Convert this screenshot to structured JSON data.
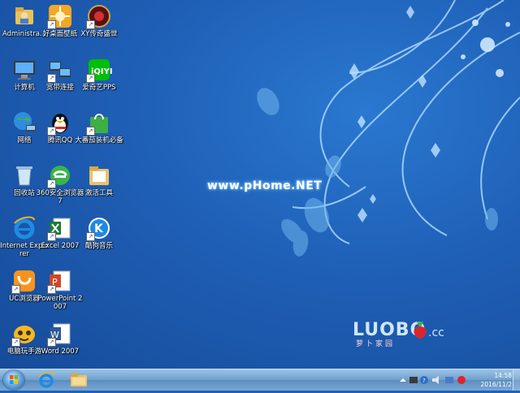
{
  "desktop": {
    "watermark": "www.pHome.NET",
    "brand": {
      "name": "LUOBO",
      "tld": ".cc",
      "subtitle": "萝卜家园"
    },
    "icons": [
      {
        "label": "Administra..."
      },
      {
        "label": "好桌面壁纸"
      },
      {
        "label": "XY传奇盛世"
      },
      {
        "label": "计算机"
      },
      {
        "label": "宽带连接"
      },
      {
        "label": "爱奇艺PPS"
      },
      {
        "label": "网络"
      },
      {
        "label": "腾讯QQ"
      },
      {
        "label": "大番茄装机必备"
      },
      {
        "label": "回收站"
      },
      {
        "label": "360安全浏览器7"
      },
      {
        "label": "激活工具"
      },
      {
        "label": "Internet Explorer"
      },
      {
        "label": "Excel 2007"
      },
      {
        "label": "酷狗音乐"
      },
      {
        "label": "UC浏览器"
      },
      {
        "label": "PowerPoint 2007"
      },
      {
        "label": "电脑玩手游"
      },
      {
        "label": "Word 2007"
      }
    ]
  },
  "taskbar": {
    "time": "14:58",
    "date": "2016/11/2"
  }
}
